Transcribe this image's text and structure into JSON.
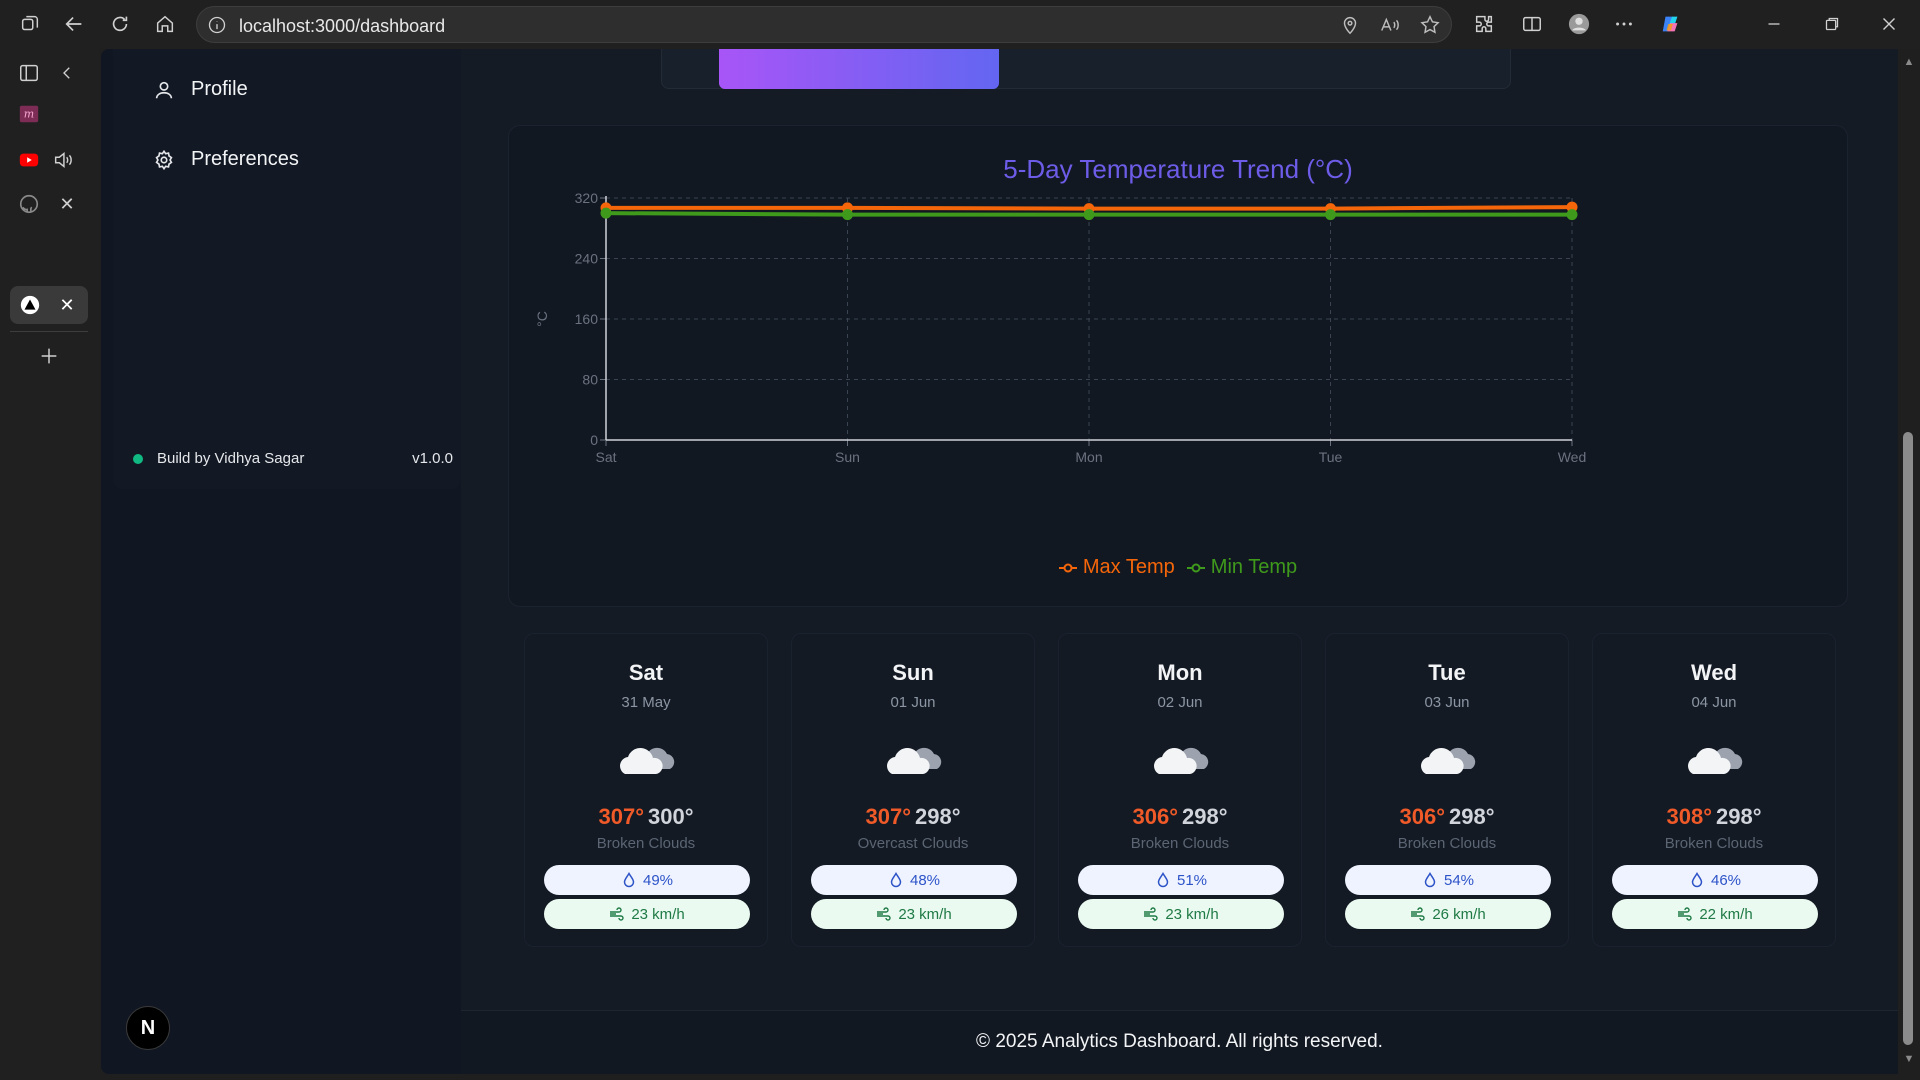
{
  "browser": {
    "url": "localhost:3000/dashboard"
  },
  "sidebar": {
    "items": [
      {
        "label": "Profile",
        "icon": "user-icon"
      },
      {
        "label": "Preferences",
        "icon": "gear-icon"
      }
    ],
    "footer": {
      "credit": "Build by Vidhya Sagar",
      "version": "v1.0.0"
    },
    "avatar_letter": "N"
  },
  "chart": {
    "title": "5-Day Temperature Trend (°C)",
    "ylabel": "°C",
    "legend": [
      "Max Temp",
      "Min Temp"
    ],
    "colors": {
      "max": "#f5660a",
      "min": "#3f9a1c"
    }
  },
  "chart_data": {
    "type": "line",
    "categories": [
      "Sat",
      "Sun",
      "Mon",
      "Tue",
      "Wed"
    ],
    "series": [
      {
        "name": "Max Temp",
        "values": [
          307,
          307,
          306,
          306,
          308
        ]
      },
      {
        "name": "Min Temp",
        "values": [
          300,
          298,
          298,
          298,
          298
        ]
      }
    ],
    "title": "5-Day Temperature Trend (°C)",
    "xlabel": "",
    "ylabel": "°C",
    "ylim": [
      0,
      320
    ],
    "yticks": [
      0,
      80,
      160,
      240,
      320
    ],
    "grid": true,
    "legend_position": "bottom"
  },
  "forecast": [
    {
      "day": "Sat",
      "date": "31 May",
      "max": "307°",
      "min": "300°",
      "desc": "Broken Clouds",
      "humidity": "49%",
      "wind": "23 km/h"
    },
    {
      "day": "Sun",
      "date": "01 Jun",
      "max": "307°",
      "min": "298°",
      "desc": "Overcast Clouds",
      "humidity": "48%",
      "wind": "23 km/h"
    },
    {
      "day": "Mon",
      "date": "02 Jun",
      "max": "306°",
      "min": "298°",
      "desc": "Broken Clouds",
      "humidity": "51%",
      "wind": "23 km/h"
    },
    {
      "day": "Tue",
      "date": "03 Jun",
      "max": "306°",
      "min": "298°",
      "desc": "Broken Clouds",
      "humidity": "54%",
      "wind": "26 km/h"
    },
    {
      "day": "Wed",
      "date": "04 Jun",
      "max": "308°",
      "min": "298°",
      "desc": "Broken Clouds",
      "humidity": "46%",
      "wind": "22 km/h"
    }
  ],
  "footer": {
    "text": "© 2025 Analytics Dashboard. All rights reserved."
  }
}
